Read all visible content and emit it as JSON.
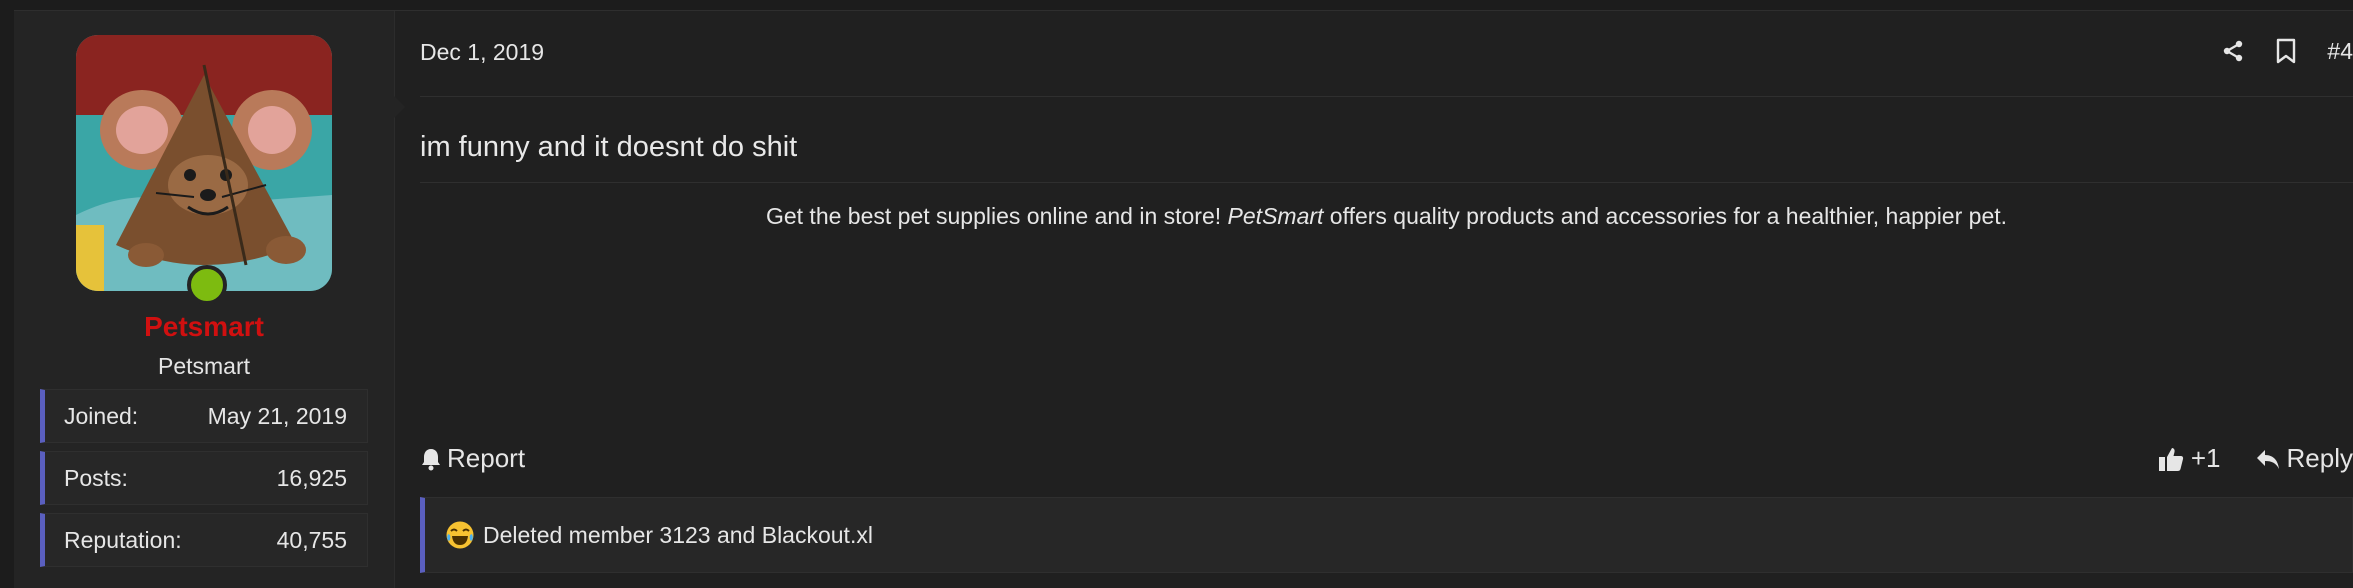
{
  "user": {
    "username": "Petsmart",
    "title": "Petsmart",
    "stats": [
      {
        "label": "Joined:",
        "value": "May 21, 2019"
      },
      {
        "label": "Posts:",
        "value": "16,925"
      },
      {
        "label": "Reputation:",
        "value": "40,755"
      }
    ],
    "username_color": "#d01010",
    "online_color": "#7dbb10"
  },
  "post": {
    "date": "Dec 1, 2019",
    "number": "#4",
    "message": "im funny and it doesnt do shit",
    "signature": {
      "before": "Get the best pet supplies online and in store! ",
      "brand": "PetSmart",
      "after": " offers quality products and accessories for a healthier, happier pet."
    }
  },
  "actions": {
    "report": "Report",
    "react": "+1",
    "reply": "Reply",
    "icons": [
      "share-icon",
      "bookmark-icon",
      "bell-icon",
      "thumbs-up-icon",
      "reply-arrow-icon",
      "laughing-emoji-icon"
    ]
  },
  "reactions": {
    "text": "Deleted member 3123 and Blackout.xl"
  },
  "colors": {
    "accent": "#5a5fbf"
  }
}
